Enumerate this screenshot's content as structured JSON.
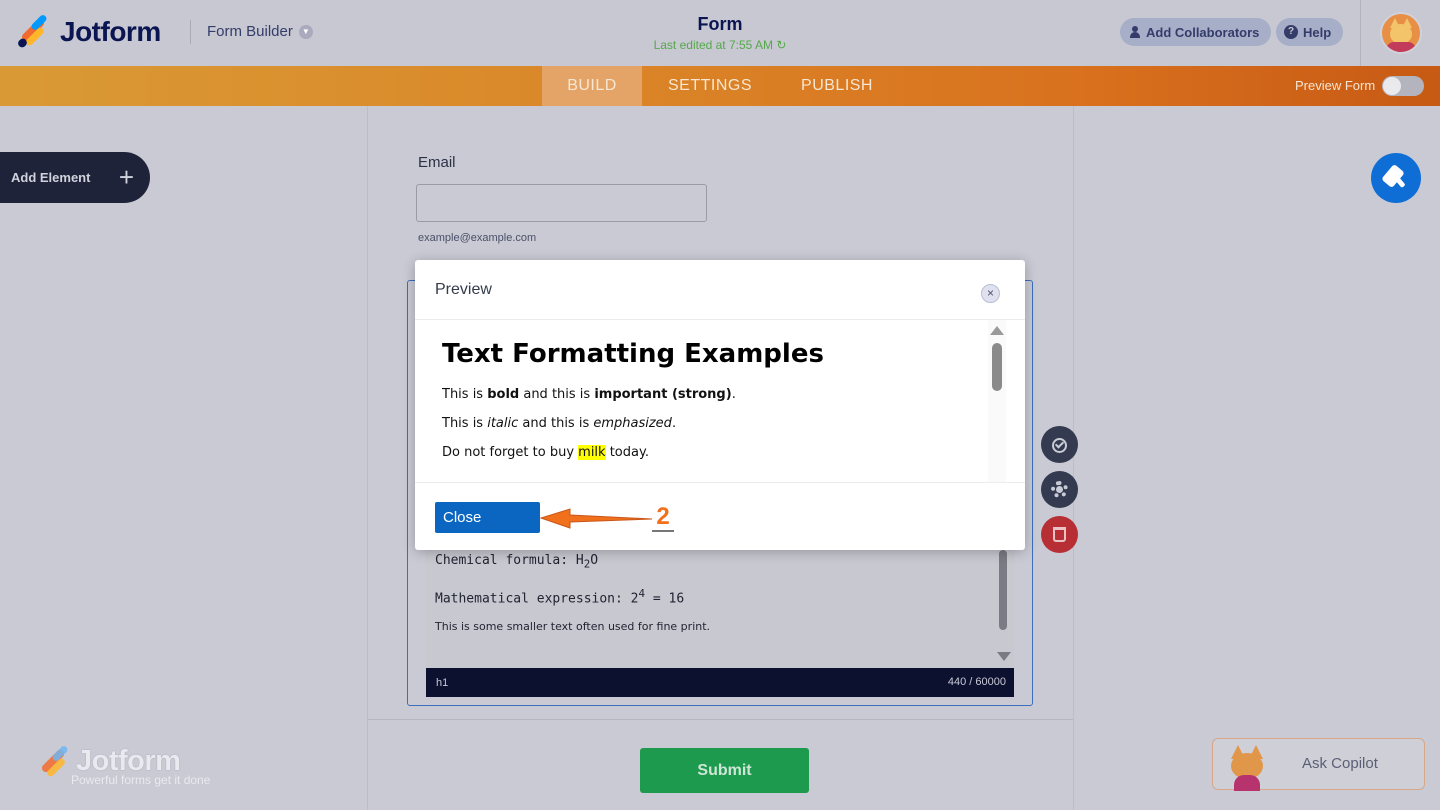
{
  "header": {
    "brand": "Jotform",
    "app_switcher": "Form Builder",
    "form_title": "Form",
    "last_edited": "Last edited at 7:55 AM",
    "add_collaborators": "Add Collaborators",
    "help": "Help"
  },
  "nav": {
    "tabs": [
      {
        "label": "BUILD",
        "active": true
      },
      {
        "label": "SETTINGS",
        "active": false
      },
      {
        "label": "PUBLISH",
        "active": false
      }
    ],
    "preview_form_label": "Preview Form",
    "preview_form_on": false
  },
  "left_panel": {
    "add_element": "Add Element"
  },
  "form": {
    "email_label": "Email",
    "email_value": "",
    "email_sublabel": "example@example.com",
    "submit": "Submit"
  },
  "editor": {
    "line1_prefix": "Chemical formula: H",
    "line1_sub": "2",
    "line1_suffix": "O",
    "line2_prefix": "Mathematical expression: 2",
    "line2_sup": "4",
    "line2_suffix": " = 16",
    "line3": "This is some smaller text often used for fine print.",
    "status_tag": "h1",
    "char_count": "440 / 60000"
  },
  "modal": {
    "title": "Preview",
    "close_icon": "×",
    "heading": "Text Formatting Examples",
    "p1": {
      "a": "This is ",
      "b": "bold",
      "c": " and this is ",
      "d": "important (strong)",
      "e": "."
    },
    "p2": {
      "a": "This is ",
      "b": "italic",
      "c": " and this is ",
      "d": "emphasized",
      "e": "."
    },
    "p3": {
      "a": "Do not forget to buy ",
      "b": "milk",
      "c": " today."
    },
    "close_button": "Close"
  },
  "annotation": {
    "step_number": "2"
  },
  "footer": {
    "brand": "Jotform",
    "tagline": "Powerful forms get it done",
    "copilot": "Ask Copilot"
  },
  "colors": {
    "accent_orange": "#d9711e",
    "primary_blue": "#0b66c2",
    "submit_green": "#1e9a4f",
    "delete_red": "#b72f35",
    "annotation_orange": "#f0701b"
  },
  "icons": [
    "jotform-logo-icon",
    "chevron-down-icon",
    "user-icon",
    "help-icon",
    "plus-icon",
    "paintbrush-icon",
    "check-circle-icon",
    "gear-icon",
    "trash-icon",
    "close-icon",
    "arrow-icon"
  ]
}
